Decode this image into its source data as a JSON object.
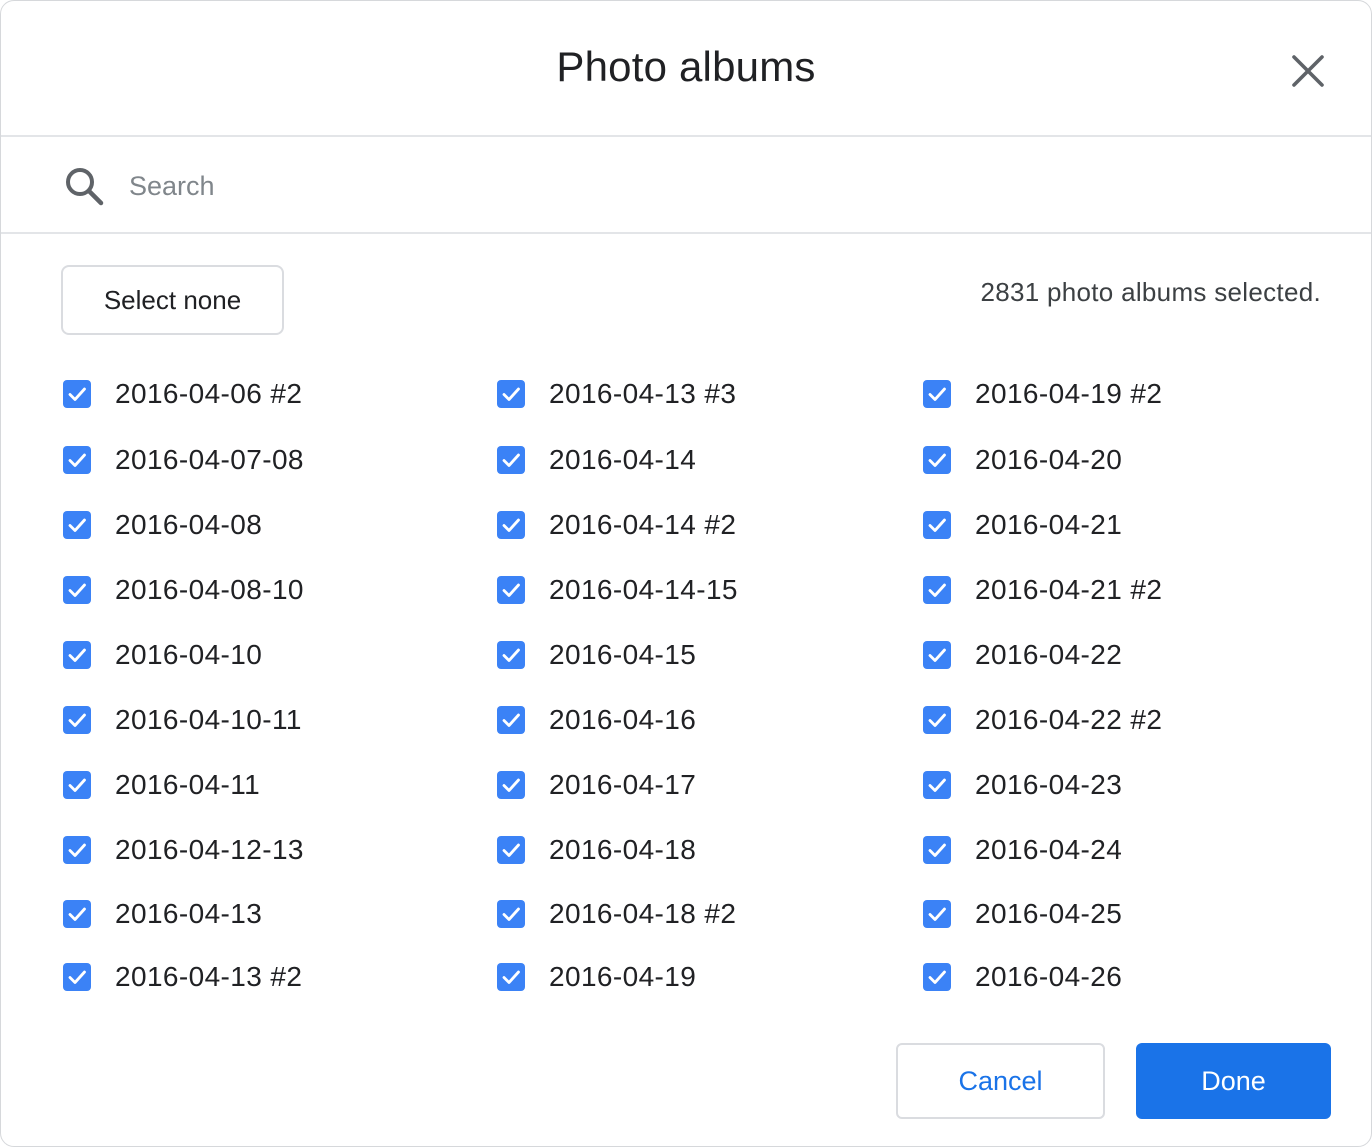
{
  "dialog": {
    "title": "Photo albums"
  },
  "search": {
    "placeholder": "Search",
    "value": ""
  },
  "toolbar": {
    "select_none_label": "Select none",
    "selected_count_text": "2831 photo albums selected."
  },
  "albums": {
    "columns": [
      [
        {
          "label": "2016-04-06 #2",
          "checked": true
        },
        {
          "label": "2016-04-07-08",
          "checked": true
        },
        {
          "label": "2016-04-08",
          "checked": true
        },
        {
          "label": "2016-04-08-10",
          "checked": true
        },
        {
          "label": "2016-04-10",
          "checked": true
        },
        {
          "label": "2016-04-10-11",
          "checked": true
        },
        {
          "label": "2016-04-11",
          "checked": true
        },
        {
          "label": "2016-04-12-13",
          "checked": true
        },
        {
          "label": "2016-04-13",
          "checked": true
        },
        {
          "label": "2016-04-13 #2",
          "checked": true
        }
      ],
      [
        {
          "label": "2016-04-13 #3",
          "checked": true
        },
        {
          "label": "2016-04-14",
          "checked": true
        },
        {
          "label": "2016-04-14 #2",
          "checked": true
        },
        {
          "label": "2016-04-14-15",
          "checked": true
        },
        {
          "label": "2016-04-15",
          "checked": true
        },
        {
          "label": "2016-04-16",
          "checked": true
        },
        {
          "label": "2016-04-17",
          "checked": true
        },
        {
          "label": "2016-04-18",
          "checked": true
        },
        {
          "label": "2016-04-18 #2",
          "checked": true
        },
        {
          "label": "2016-04-19",
          "checked": true
        }
      ],
      [
        {
          "label": "2016-04-19 #2",
          "checked": true
        },
        {
          "label": "2016-04-20",
          "checked": true
        },
        {
          "label": "2016-04-21",
          "checked": true
        },
        {
          "label": "2016-04-21 #2",
          "checked": true
        },
        {
          "label": "2016-04-22",
          "checked": true
        },
        {
          "label": "2016-04-22 #2",
          "checked": true
        },
        {
          "label": "2016-04-23",
          "checked": true
        },
        {
          "label": "2016-04-24",
          "checked": true
        },
        {
          "label": "2016-04-25",
          "checked": true
        },
        {
          "label": "2016-04-26",
          "checked": true
        }
      ]
    ]
  },
  "footer": {
    "cancel_label": "Cancel",
    "done_label": "Done"
  },
  "icons": {
    "close": "close-icon",
    "search": "search-icon",
    "checkbox": "checkbox-checked-icon"
  },
  "colors": {
    "accent": "#1a73e8",
    "checkbox": "#3b82f6"
  }
}
